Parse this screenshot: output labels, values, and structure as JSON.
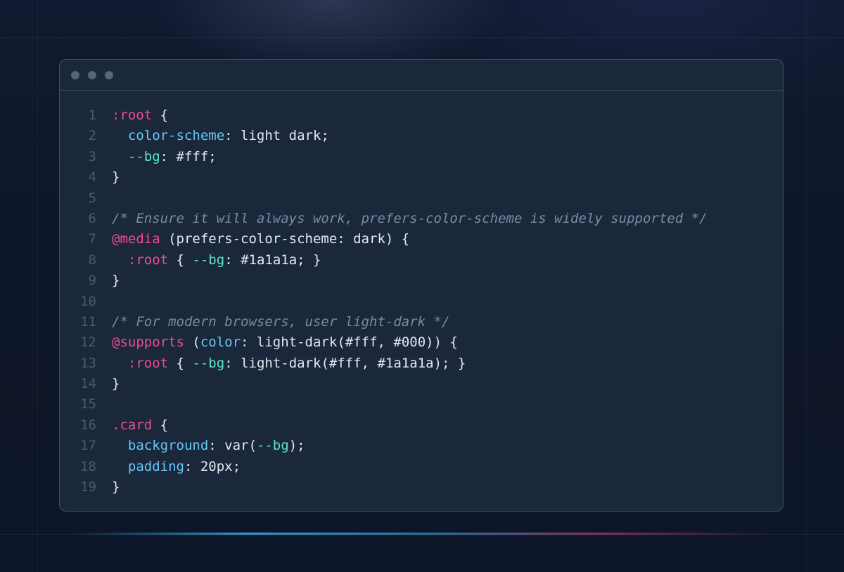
{
  "window": {
    "dots": [
      "red",
      "yellow",
      "green"
    ]
  },
  "colors": {
    "background": "#0e1729",
    "panel": "#1b283c",
    "selector": "#ec4c9a",
    "property": "#66c7f2",
    "variable": "#5ee3c8",
    "text": "#e2e8f0",
    "comment": "#7a8aa0",
    "line_number": "#4a5a6e"
  },
  "code": {
    "lines": [
      {
        "n": "1",
        "tokens": [
          {
            "t": ":root",
            "c": "sel"
          },
          {
            "t": " {",
            "c": "txt"
          }
        ]
      },
      {
        "n": "2",
        "tokens": [
          {
            "t": "  ",
            "c": "txt"
          },
          {
            "t": "color-scheme",
            "c": "prop"
          },
          {
            "t": ": light dark;",
            "c": "txt"
          }
        ]
      },
      {
        "n": "3",
        "tokens": [
          {
            "t": "  ",
            "c": "txt"
          },
          {
            "t": "--bg",
            "c": "var"
          },
          {
            "t": ": #fff;",
            "c": "txt"
          }
        ]
      },
      {
        "n": "4",
        "tokens": [
          {
            "t": "}",
            "c": "txt"
          }
        ]
      },
      {
        "n": "5",
        "tokens": []
      },
      {
        "n": "6",
        "tokens": [
          {
            "t": "/* Ensure it will always work, prefers-color-scheme is widely supported */",
            "c": "com"
          }
        ]
      },
      {
        "n": "7",
        "tokens": [
          {
            "t": "@media",
            "c": "sel"
          },
          {
            "t": " (prefers-color-scheme: dark) {",
            "c": "txt"
          }
        ]
      },
      {
        "n": "8",
        "tokens": [
          {
            "t": "  ",
            "c": "txt"
          },
          {
            "t": ":root",
            "c": "sel"
          },
          {
            "t": " { ",
            "c": "txt"
          },
          {
            "t": "--bg",
            "c": "var"
          },
          {
            "t": ": #1a1a1a; }",
            "c": "txt"
          }
        ]
      },
      {
        "n": "9",
        "tokens": [
          {
            "t": "}",
            "c": "txt"
          }
        ]
      },
      {
        "n": "10",
        "tokens": []
      },
      {
        "n": "11",
        "tokens": [
          {
            "t": "/* For modern browsers, user light-dark */",
            "c": "com"
          }
        ]
      },
      {
        "n": "12",
        "tokens": [
          {
            "t": "@supports",
            "c": "sel"
          },
          {
            "t": " (",
            "c": "txt"
          },
          {
            "t": "color",
            "c": "prop"
          },
          {
            "t": ": light-dark(#fff, #000)) {",
            "c": "txt"
          }
        ]
      },
      {
        "n": "13",
        "tokens": [
          {
            "t": "  ",
            "c": "txt"
          },
          {
            "t": ":root",
            "c": "sel"
          },
          {
            "t": " { ",
            "c": "txt"
          },
          {
            "t": "--bg",
            "c": "var"
          },
          {
            "t": ": light-dark(#fff, #1a1a1a); }",
            "c": "txt"
          }
        ]
      },
      {
        "n": "14",
        "tokens": [
          {
            "t": "}",
            "c": "txt"
          }
        ]
      },
      {
        "n": "15",
        "tokens": []
      },
      {
        "n": "16",
        "tokens": [
          {
            "t": ".card",
            "c": "sel"
          },
          {
            "t": " {",
            "c": "txt"
          }
        ]
      },
      {
        "n": "17",
        "tokens": [
          {
            "t": "  ",
            "c": "txt"
          },
          {
            "t": "background",
            "c": "prop"
          },
          {
            "t": ": var(",
            "c": "txt"
          },
          {
            "t": "--bg",
            "c": "var"
          },
          {
            "t": ");",
            "c": "txt"
          }
        ]
      },
      {
        "n": "18",
        "tokens": [
          {
            "t": "  ",
            "c": "txt"
          },
          {
            "t": "padding",
            "c": "prop"
          },
          {
            "t": ": 20px;",
            "c": "txt"
          }
        ]
      },
      {
        "n": "19",
        "tokens": [
          {
            "t": "}",
            "c": "txt"
          }
        ]
      }
    ]
  }
}
